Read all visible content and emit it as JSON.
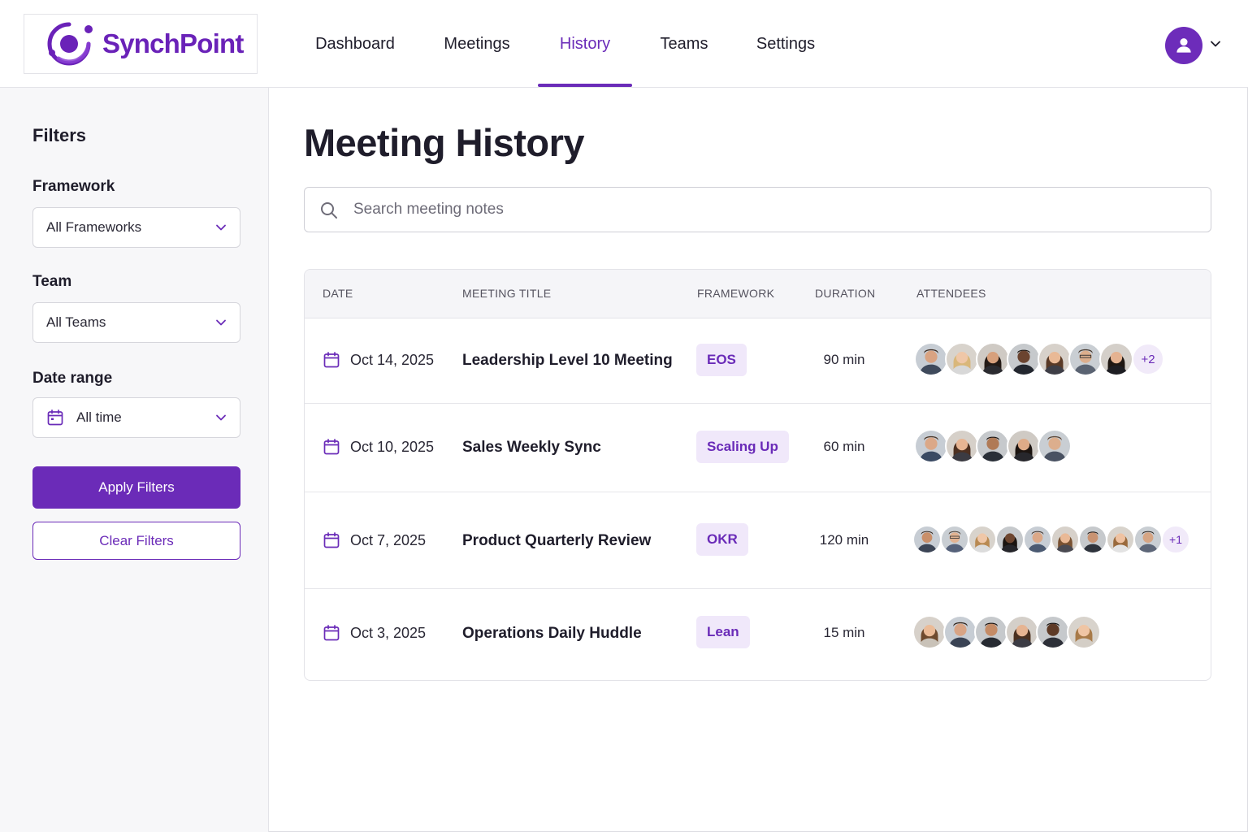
{
  "app": {
    "name": "SynchPoint",
    "brand_color": "#6b2bb8"
  },
  "nav": {
    "items": [
      {
        "label": "Dashboard",
        "active": false
      },
      {
        "label": "Meetings",
        "active": false
      },
      {
        "label": "History",
        "active": true
      },
      {
        "label": "Teams",
        "active": false
      },
      {
        "label": "Settings",
        "active": false
      }
    ],
    "user_icon": "user-icon"
  },
  "sidebar": {
    "title": "Filters",
    "framework": {
      "label": "Framework",
      "value": "All Frameworks"
    },
    "team": {
      "label": "Team",
      "value": "All Teams"
    },
    "date_range": {
      "label": "Date range",
      "value": "All time"
    },
    "apply_label": "Apply Filters",
    "clear_label": "Clear Filters"
  },
  "main": {
    "title": "Meeting History",
    "search": {
      "placeholder": "Search meeting notes",
      "value": ""
    },
    "table": {
      "columns": [
        "DATE",
        "MEETING TITLE",
        "FRAMEWORK",
        "DURATION",
        "ATTENDEES"
      ],
      "rows": [
        {
          "date": "Oct 14, 2025",
          "title": "Leadership Level 10 Meeting",
          "framework": "EOS",
          "duration": "90 min",
          "attendee_count_shown": 7,
          "more": "+2"
        },
        {
          "date": "Oct 10, 2025",
          "title": "Sales Weekly Sync",
          "framework": "Scaling Up",
          "duration": "60 min",
          "attendee_count_shown": 5,
          "more": ""
        },
        {
          "date": "Oct 7, 2025",
          "title": "Product Quarterly Review",
          "framework": "OKR",
          "duration": "120 min",
          "attendee_count_shown": 9,
          "more": "+1"
        },
        {
          "date": "Oct 3, 2025",
          "title": "Operations Daily Huddle",
          "framework": "Lean",
          "duration": "15 min",
          "attendee_count_shown": 6,
          "more": ""
        }
      ]
    }
  }
}
